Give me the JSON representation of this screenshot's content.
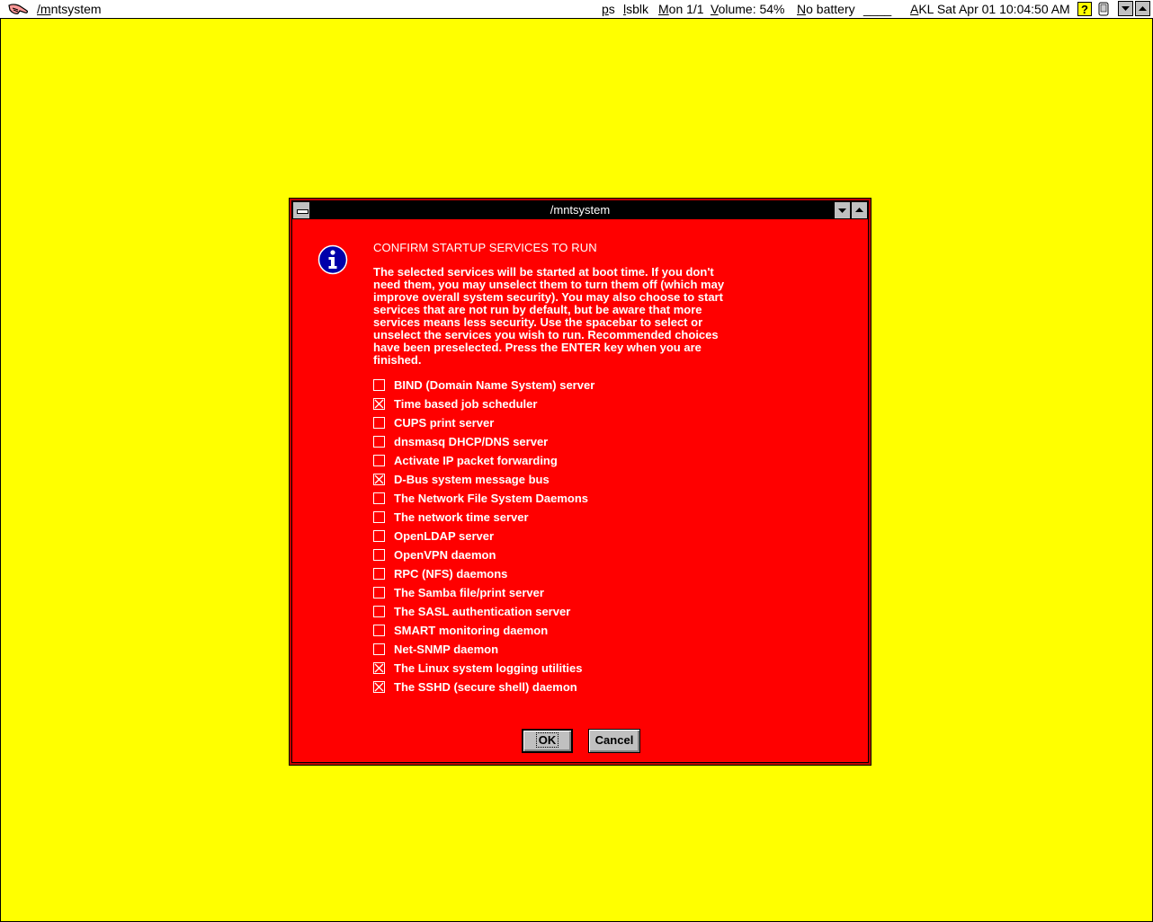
{
  "topbar": {
    "app_title": "/mntsystem",
    "items": {
      "ps": "ps",
      "lsblk": "lsblk",
      "workspace": "Mon 1/1",
      "volume": "Volume: 54%",
      "battery": "No battery",
      "blank": "____",
      "clock": "AKL Sat Apr 01 10:04:50 AM"
    }
  },
  "dialog": {
    "title": "/mntsystem",
    "heading": "CONFIRM STARTUP SERVICES TO RUN",
    "description_lines": [
      "The selected services will be started at boot time. If you don't",
      "need them, you may unselect them to turn them off (which may",
      "improve overall system security). You may also choose to start",
      "services that are not run by default, but be aware that more",
      "services means less security. Use the spacebar to select or",
      "unselect the services you wish to run. Recommended choices",
      "have been preselected. Press the ENTER key when you are",
      "finished."
    ],
    "services": [
      {
        "label": "BIND (Domain Name System) server",
        "checked": false
      },
      {
        "label": "Time based job scheduler",
        "checked": true
      },
      {
        "label": "CUPS print server",
        "checked": false
      },
      {
        "label": "dnsmasq DHCP/DNS server",
        "checked": false
      },
      {
        "label": "Activate IP packet forwarding",
        "checked": false
      },
      {
        "label": "D-Bus system message bus",
        "checked": true
      },
      {
        "label": "The Network File System Daemons",
        "checked": false
      },
      {
        "label": "The network time server",
        "checked": false
      },
      {
        "label": "OpenLDAP server",
        "checked": false
      },
      {
        "label": "OpenVPN daemon",
        "checked": false
      },
      {
        "label": "RPC (NFS) daemons",
        "checked": false
      },
      {
        "label": "The Samba file/print server",
        "checked": false
      },
      {
        "label": "The SASL authentication server",
        "checked": false
      },
      {
        "label": "SMART monitoring daemon",
        "checked": false
      },
      {
        "label": "Net-SNMP daemon",
        "checked": false
      },
      {
        "label": "The Linux system logging utilities",
        "checked": true
      },
      {
        "label": "The SSHD (secure shell) daemon",
        "checked": true
      }
    ],
    "ok_label": "OK",
    "cancel_label": "Cancel"
  },
  "colors": {
    "desktop": "#ffff00",
    "dialog_bg": "#ff0000",
    "titlebar": "#000000",
    "text": "#ffffff",
    "info_icon": "#0000aa"
  },
  "icons": {
    "app": "hand-icon",
    "info": "info-icon",
    "help": "help-icon",
    "phone": "device-icon",
    "dropdown": "chevron-down-icon",
    "minimize": "minimize-icon",
    "maximize": "maximize-icon",
    "system_menu": "system-menu-icon"
  }
}
